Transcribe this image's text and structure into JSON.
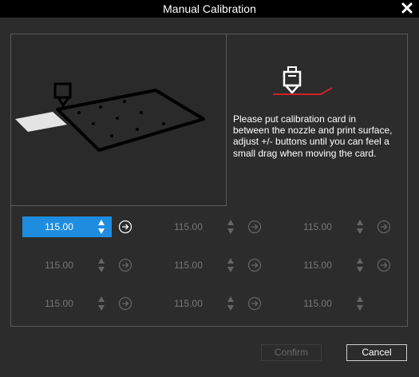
{
  "window": {
    "title": "Manual Calibration"
  },
  "instructions": "Please put calibration card in between the nozzle and print surface, adjust +/- buttons until you can feel a small drag when moving the card.",
  "grid": {
    "rows": [
      [
        {
          "value": "115.00",
          "active": true
        },
        {
          "value": "115.00",
          "active": false
        },
        {
          "value": "115.00",
          "active": false
        }
      ],
      [
        {
          "value": "115.00",
          "active": false
        },
        {
          "value": "115.00",
          "active": false
        },
        {
          "value": "115.00",
          "active": false
        }
      ],
      [
        {
          "value": "115.00",
          "active": false
        },
        {
          "value": "115.00",
          "active": false
        },
        {
          "value": "115.00",
          "active": false
        }
      ]
    ]
  },
  "buttons": {
    "confirm": "Confirm",
    "cancel": "Cancel"
  },
  "colors": {
    "accent": "#1e8de0",
    "nozzle_line": "#d0202a"
  }
}
